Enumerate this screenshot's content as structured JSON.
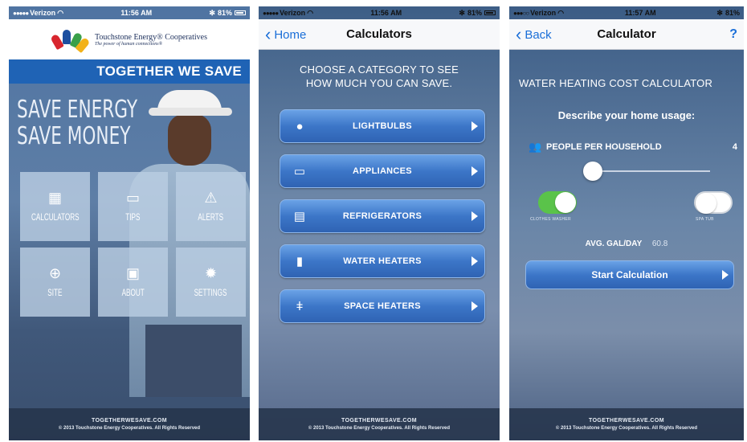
{
  "status_bars": [
    {
      "carrier": "Verizon",
      "time": "11:56 AM",
      "battery": "81%"
    },
    {
      "carrier": "Verizon",
      "time": "11:56 AM",
      "battery": "81%"
    },
    {
      "carrier": "Verizon",
      "time": "11:57 AM",
      "battery": "81%"
    }
  ],
  "home": {
    "logo_name": "Touchstone Energy® Cooperatives",
    "logo_tagline": "The power of human connections®",
    "banner": "TOGETHER WE SAVE",
    "hero_line1": "SAVE ENERGY",
    "hero_line2": "SAVE MONEY",
    "tiles": [
      {
        "label": "CALCULATORS",
        "icon": "calculator-icon",
        "glyph": "▦"
      },
      {
        "label": "TIPS",
        "icon": "chat-bubble-icon",
        "glyph": "▭"
      },
      {
        "label": "ALERTS",
        "icon": "warning-icon",
        "glyph": "⚠"
      },
      {
        "label": "SITE",
        "icon": "globe-icon",
        "glyph": "⊕"
      },
      {
        "label": "ABOUT",
        "icon": "id-card-icon",
        "glyph": "▣"
      },
      {
        "label": "SETTINGS",
        "icon": "gear-icon",
        "glyph": "✹"
      }
    ]
  },
  "footer": {
    "site": "TOGETHERWESAVE.COM",
    "copyright": "© 2013 Touchstone Energy Cooperatives. All Rights Reserved"
  },
  "calculators": {
    "back_label": "Home",
    "title": "Calculators",
    "prompt_line1": "CHOOSE A CATEGORY TO SEE",
    "prompt_line2": "HOW MUCH YOU CAN SAVE.",
    "categories": [
      {
        "label": "LIGHTBULBS",
        "icon": "lightbulb-icon",
        "glyph": "💡"
      },
      {
        "label": "APPLIANCES",
        "icon": "tv-icon",
        "glyph": "📺"
      },
      {
        "label": "REFRIGERATORS",
        "icon": "refrigerator-icon",
        "glyph": "▤"
      },
      {
        "label": "WATER HEATERS",
        "icon": "water-heater-icon",
        "glyph": "▮"
      },
      {
        "label": "SPACE HEATERS",
        "icon": "thermometer-icon",
        "glyph": "🌡"
      }
    ]
  },
  "calculator": {
    "back_label": "Back",
    "title": "Calculator",
    "help": "?",
    "heading": "WATER HEATING COST CALCULATOR",
    "usage_prompt": "Describe your home usage:",
    "people_label": "PEOPLE PER HOUSEHOLD",
    "people_value": "4",
    "slider_fraction": 0.0,
    "toggle1_label": "CLOTHES WASHER",
    "toggle1_on": true,
    "toggle2_label": "SPA TUB",
    "toggle2_on": false,
    "avg_label": "AVG. GAL/DAY",
    "avg_value": "60.8",
    "start_label": "Start Calculation"
  }
}
